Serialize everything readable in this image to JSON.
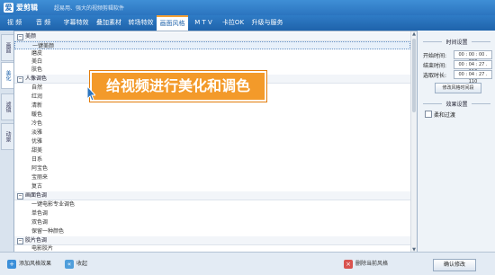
{
  "app": {
    "name": "爱剪辑",
    "slogan": "超易用、强大的视频剪辑软件",
    "logo_text": "爱"
  },
  "menu": {
    "items": [
      {
        "label": "视  频"
      },
      {
        "label": "音  频"
      },
      {
        "label": "字幕特效"
      },
      {
        "label": "叠加素材"
      },
      {
        "label": "转场特效"
      },
      {
        "label": "画面风格",
        "active": true
      },
      {
        "label": "M T V"
      },
      {
        "label": "卡拉OK"
      },
      {
        "label": "升级与服务"
      }
    ]
  },
  "side_tabs": [
    {
      "label": "画面"
    },
    {
      "label": "美化",
      "active": true
    },
    {
      "label": "滤镜"
    },
    {
      "label": "动景"
    }
  ],
  "style_list": {
    "groups": [
      {
        "title": "美颜",
        "items": [
          {
            "label": "一键美颜",
            "selected": true
          },
          {
            "label": "磨皮"
          },
          {
            "label": "美白"
          },
          {
            "label": "肤色"
          }
        ]
      },
      {
        "title": "人像调色",
        "items": [
          {
            "label": "自然"
          },
          {
            "label": "红润"
          },
          {
            "label": "清新"
          },
          {
            "label": "暖色"
          },
          {
            "label": "冷色"
          },
          {
            "label": "淡雅"
          },
          {
            "label": "优雅"
          },
          {
            "label": "甜美"
          },
          {
            "label": "日系"
          },
          {
            "label": "阿宝色"
          },
          {
            "label": "宝丽来"
          },
          {
            "label": "复古"
          }
        ]
      },
      {
        "title": "画面色调",
        "items": [
          {
            "label": "一键电影专业调色"
          },
          {
            "label": "单色调"
          },
          {
            "label": "双色调"
          },
          {
            "label": "保留一种颜色"
          }
        ]
      },
      {
        "title": "胶片色调",
        "items": [
          {
            "label": "电影胶片"
          }
        ]
      }
    ]
  },
  "tooltip": {
    "text": "给视频进行美化和调色"
  },
  "time_settings": {
    "title": "时间设置",
    "start_label": "开始时间:",
    "start_value": "00 : 00 : 00 . 000",
    "end_label": "结束时间:",
    "end_value": "00 : 04 : 27 . 110",
    "duration_label": "选取时长:",
    "duration_value": "00 : 04 : 27 . 110",
    "modify_button": "修改风格时间段"
  },
  "effect_settings": {
    "title": "效果设置",
    "soft_transition_label": "柔和过渡",
    "soft_transition_checked": false
  },
  "bottom": {
    "add_label": "添加风格效果",
    "collect_label": "收起",
    "delete_label": "删除当前风格",
    "confirm_label": "确认修改"
  },
  "colors": {
    "accent_blue": "#2b74bf",
    "tooltip_orange": "#f39a2a"
  }
}
